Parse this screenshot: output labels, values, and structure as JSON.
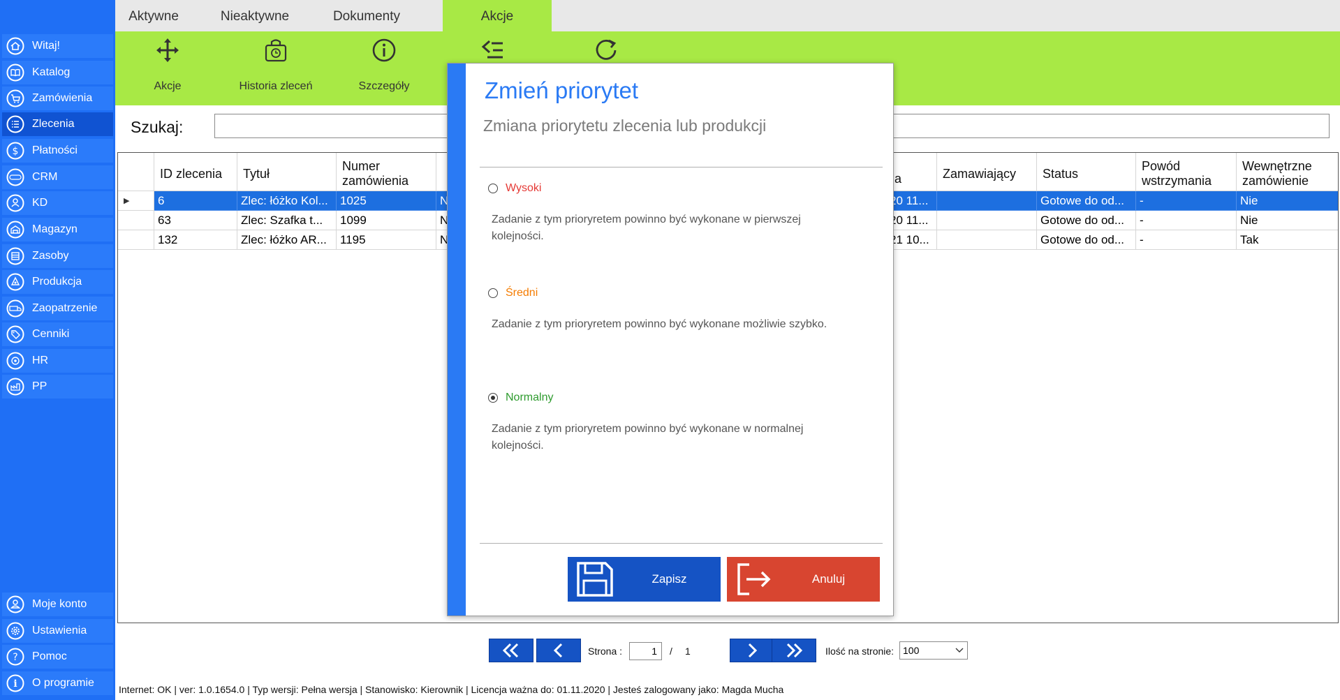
{
  "sidebar": {
    "items": [
      {
        "label": "Witaj!",
        "icon": "home-icon"
      },
      {
        "label": "Katalog",
        "icon": "book-icon"
      },
      {
        "label": "Zamówienia",
        "icon": "cart-icon"
      },
      {
        "label": "Zlecenia",
        "icon": "list-icon"
      },
      {
        "label": "Płatności",
        "icon": "dollar-icon"
      },
      {
        "label": "CRM",
        "icon": "crm-icon"
      },
      {
        "label": "KD",
        "icon": "person-icon"
      },
      {
        "label": "Magazyn",
        "icon": "warehouse-icon"
      },
      {
        "label": "Zasoby",
        "icon": "resources-icon"
      },
      {
        "label": "Produkcja",
        "icon": "production-icon"
      },
      {
        "label": "Zaopatrzenie",
        "icon": "truck-icon"
      },
      {
        "label": "Cenniki",
        "icon": "tag-icon"
      },
      {
        "label": "HR",
        "icon": "hr-icon"
      },
      {
        "label": "PP",
        "icon": "pp-icon"
      }
    ],
    "active": "Zlecenia",
    "bottom_items": [
      {
        "label": "Moje konto",
        "icon": "user-icon"
      },
      {
        "label": "Ustawienia",
        "icon": "settings-icon"
      },
      {
        "label": "Pomoc",
        "icon": "help-icon"
      },
      {
        "label": "O programie",
        "icon": "info-icon"
      }
    ]
  },
  "tabs": [
    "Aktywne",
    "Nieaktywne",
    "Dokumenty",
    "Akcje"
  ],
  "active_tab": "Akcje",
  "ribbon": {
    "buttons": [
      {
        "label": "Akcje",
        "icon": "move-icon"
      },
      {
        "label": "Historia zleceń",
        "icon": "history-icon"
      },
      {
        "label": "Szczegóły",
        "icon": "info-icon"
      },
      {
        "label": "",
        "icon": "priority-icon"
      },
      {
        "label": "",
        "icon": "refresh-icon"
      }
    ]
  },
  "search": {
    "label": "Szukaj:",
    "value": ""
  },
  "grid": {
    "columns": [
      "ID zlecenia",
      "Tytuł",
      "Numer zamówienia",
      "",
      "ia",
      "Zamawiający",
      "Status",
      "Powód wstrzymania",
      "Wewnętrzne zamówienie"
    ],
    "rows": [
      {
        "id": "6",
        "title": "Zlec: łóżko Kol...",
        "order": "1025",
        "col4": "N",
        "col5": "20 11...",
        "ordering": "",
        "status": "Gotowe do od...",
        "reason": "-",
        "internal": "Nie",
        "selected": true
      },
      {
        "id": "63",
        "title": "Zlec: Szafka t...",
        "order": "1099",
        "col4": "N",
        "col5": "20 11...",
        "ordering": "",
        "status": "Gotowe do od...",
        "reason": "-",
        "internal": "Nie",
        "selected": false
      },
      {
        "id": "132",
        "title": "Zlec: łóżko AR...",
        "order": "1195",
        "col4": "N",
        "col5": "21 10...",
        "ordering": "",
        "status": "Gotowe do od...",
        "reason": "-",
        "internal": "Tak",
        "selected": false
      }
    ]
  },
  "pager": {
    "page_label": "Strona :",
    "current_page": "1",
    "separator": "/",
    "total_pages": "1",
    "per_page_label": "Ilość na stronie:",
    "per_page": "100"
  },
  "status_bar": "Internet: OK  |   ver: 1.0.1654.0   |   Typ wersji: Pełna wersja   |   Stanowisko: Kierownik   |   Licencja ważna do: 01.11.2020  |   Jesteś zalogowany jako: Magda Mucha",
  "modal": {
    "title": "Zmień priorytet",
    "subtitle": "Zmiana priorytetu zlecenia lub produkcji",
    "options": [
      {
        "label": "Wysoki",
        "description": "Zadanie z tym prioryretem powinno być wykonane w pierwszej kolejności.",
        "color": "#e53935",
        "checked": false
      },
      {
        "label": "Średni",
        "description": "Zadanie z tym prioryretem powinno być wykonane możliwie szybko.",
        "color": "#f57c00",
        "checked": false
      },
      {
        "label": "Normalny",
        "description": "Zadanie z tym prioryretem powinno być wykonane w normalnej kolejności.",
        "color": "#2e9b2e",
        "checked": true
      }
    ],
    "save_label": "Zapisz",
    "cancel_label": "Anuluj"
  },
  "colors": {
    "sidebar": "#1f6ff5",
    "ribbon": "#a8e945",
    "accent": "#2a7af4",
    "save": "#1553c4",
    "cancel": "#d84530",
    "selection": "#1d6fe0"
  }
}
